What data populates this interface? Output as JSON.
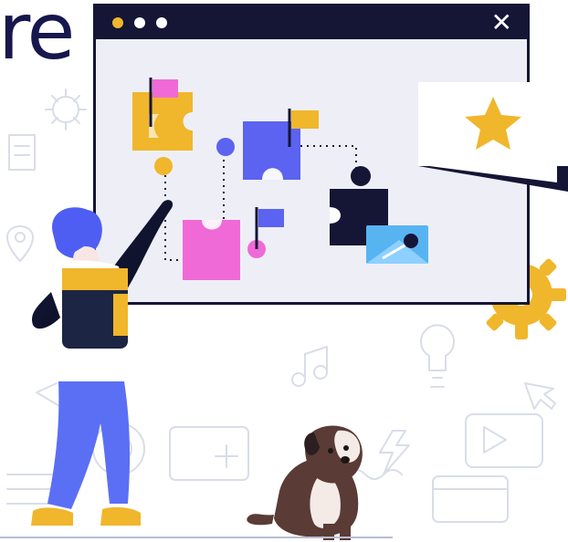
{
  "heading_fragment": "re",
  "window": {
    "close_symbol": "✕"
  },
  "colors": {
    "window_frame": "#151536",
    "board_background": "#eeeff6",
    "puzzle_yellow": "#f0b62c",
    "puzzle_blue": "#5b63f0",
    "puzzle_pink": "#f06ad7",
    "puzzle_dark": "#151536",
    "star_yellow": "#f0b62c",
    "person_hair": "#4f5ef2",
    "person_pants": "#5b6ff5",
    "backpack_dark": "#1c2543",
    "dog_brown": "#5a3b35",
    "doodle_gray": "#d9dde8"
  },
  "icons": {
    "close": "close-icon",
    "star": "star-icon",
    "image": "image-icon",
    "gear": "gear-icon"
  }
}
